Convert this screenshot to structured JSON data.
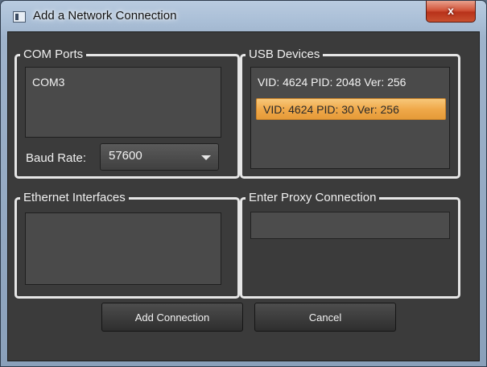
{
  "window": {
    "title": "Add a Network Connection",
    "close_label": "x"
  },
  "com_ports": {
    "label": "COM Ports",
    "items": [
      "COM3"
    ],
    "baud_label": "Baud Rate:",
    "baud_value": "57600"
  },
  "usb_devices": {
    "label": "USB Devices",
    "items": [
      "VID: 4624 PID: 2048 Ver: 256",
      "VID: 4624 PID: 30 Ver: 256"
    ],
    "selected_index": 1
  },
  "ethernet": {
    "label": "Ethernet Interfaces",
    "items": []
  },
  "proxy": {
    "label": "Enter Proxy Connection",
    "value": ""
  },
  "buttons": {
    "add": "Add Connection",
    "cancel": "Cancel"
  },
  "colors": {
    "selection": "#f0a94a",
    "client_bg": "#3b3b3b",
    "close_button": "#c9502f"
  }
}
